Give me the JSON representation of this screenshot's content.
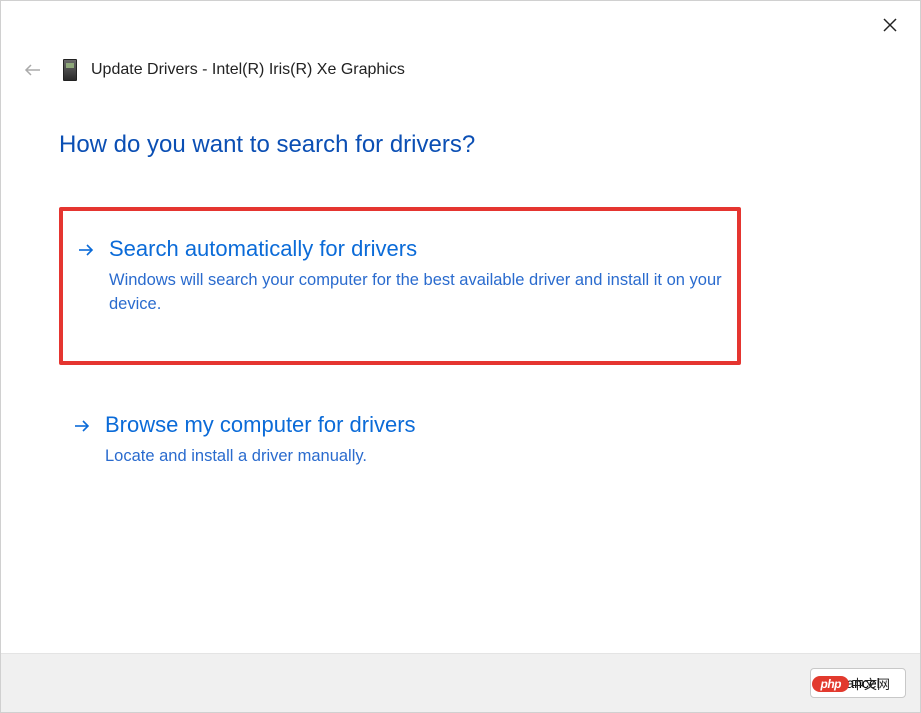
{
  "window": {
    "title": "Update Drivers - Intel(R) Iris(R) Xe Graphics"
  },
  "heading": "How do you want to search for drivers?",
  "options": {
    "auto": {
      "title": "Search automatically for drivers",
      "desc": "Windows will search your computer for the best available driver and install it on your device."
    },
    "browse": {
      "title": "Browse my computer for drivers",
      "desc": "Locate and install a driver manually."
    }
  },
  "footer": {
    "cancel_label": "Cancel"
  },
  "watermark": {
    "logo": "php",
    "text": "中文网"
  }
}
